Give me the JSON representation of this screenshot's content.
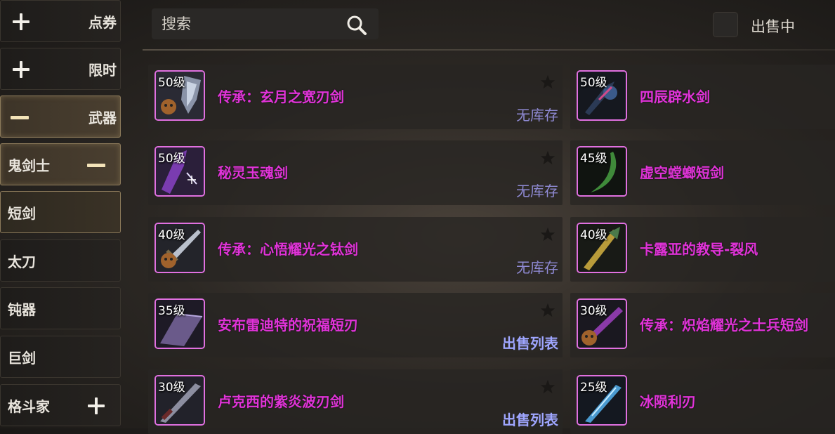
{
  "sidebar": {
    "items": [
      {
        "label": "点券",
        "icon": "plus-icon"
      },
      {
        "label": "限时",
        "icon": "plus-icon"
      },
      {
        "label": "武器",
        "icon": "minus-icon"
      },
      {
        "label": "鬼剑士",
        "icon": "minus-icon"
      },
      {
        "label": "短剑"
      },
      {
        "label": "太刀"
      },
      {
        "label": "钝器"
      },
      {
        "label": "巨剑"
      },
      {
        "label": "格斗家",
        "icon": "plus-icon"
      }
    ]
  },
  "search": {
    "placeholder": "搜索",
    "icon": "search-icon"
  },
  "filter": {
    "on_sale_label": "出售中",
    "checked": false
  },
  "colors": {
    "rarity_epic": "#e033d8",
    "status_text": "#8f8ad4",
    "accent_gold": "#8c7a5a"
  },
  "items": [
    {
      "level": "50级",
      "name": "传承：玄月之宽刃剑",
      "status": "无库存",
      "favorite_icon": "star-icon"
    },
    {
      "level": "50级",
      "name": "四辰辟水剑"
    },
    {
      "level": "50级",
      "name": "秘灵玉魂剑",
      "status": "无库存",
      "favorite_icon": "star-icon"
    },
    {
      "level": "45级",
      "name": "虚空螳螂短剑"
    },
    {
      "level": "40级",
      "name": "传承：心悟耀光之钛剑",
      "status": "无库存",
      "favorite_icon": "star-icon"
    },
    {
      "level": "40级",
      "name": "卡露亚的教导-裂风"
    },
    {
      "level": "35级",
      "name": "安布雷迪特的祝福短刃",
      "status": "出售列表",
      "favorite_icon": "star-icon"
    },
    {
      "level": "30级",
      "name": "传承：炽焰耀光之士兵短剑"
    },
    {
      "level": "30级",
      "name": "卢克西的紫炎波刃剑",
      "status": "出售列表",
      "favorite_icon": "star-icon"
    },
    {
      "level": "25级",
      "name": "冰陨利刃"
    }
  ]
}
